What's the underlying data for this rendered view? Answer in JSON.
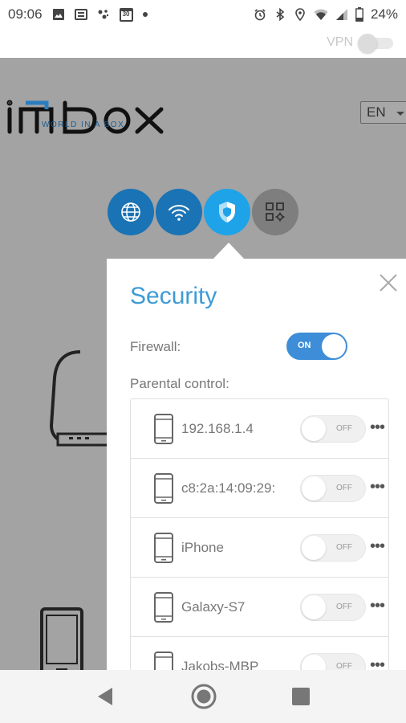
{
  "status_bar": {
    "time": "09:06",
    "battery": "24%",
    "calendar_date": "30",
    "left_icons": [
      "image-icon",
      "news-icon",
      "assistant-icon",
      "calendar-icon",
      "dot-icon"
    ],
    "right_icons": [
      "alarm-icon",
      "bluetooth-icon",
      "location-icon",
      "wifi-signal-icon",
      "cell-signal-icon",
      "battery-icon"
    ]
  },
  "vpn": {
    "label": "VPN",
    "enabled": false
  },
  "header": {
    "logo_text": "imbox",
    "tagline": "WORLD IN A BOX",
    "language": "EN"
  },
  "nav": {
    "icons": [
      "globe-icon",
      "wifi-icon",
      "shield-icon",
      "apps-settings-icon"
    ],
    "active": "shield-icon"
  },
  "panel": {
    "title": "Security",
    "firewall_label": "Firewall:",
    "firewall_state": "ON",
    "parental_label": "Parental control:",
    "devices": [
      {
        "name": "192.168.1.4",
        "state": "OFF"
      },
      {
        "name": "c8:2a:14:09:29:",
        "state": "OFF"
      },
      {
        "name": "iPhone",
        "state": "OFF"
      },
      {
        "name": "Galaxy-S7",
        "state": "OFF"
      },
      {
        "name": "Jakobs-MBP",
        "state": "OFF"
      }
    ],
    "more_label": "•••"
  },
  "colors": {
    "primary_blue": "#1a73b5",
    "active_blue": "#1fa3e8",
    "title_blue": "#3d9bd6",
    "toggle_on": "#3d8dd8",
    "background_gray": "#a3a3a3"
  }
}
